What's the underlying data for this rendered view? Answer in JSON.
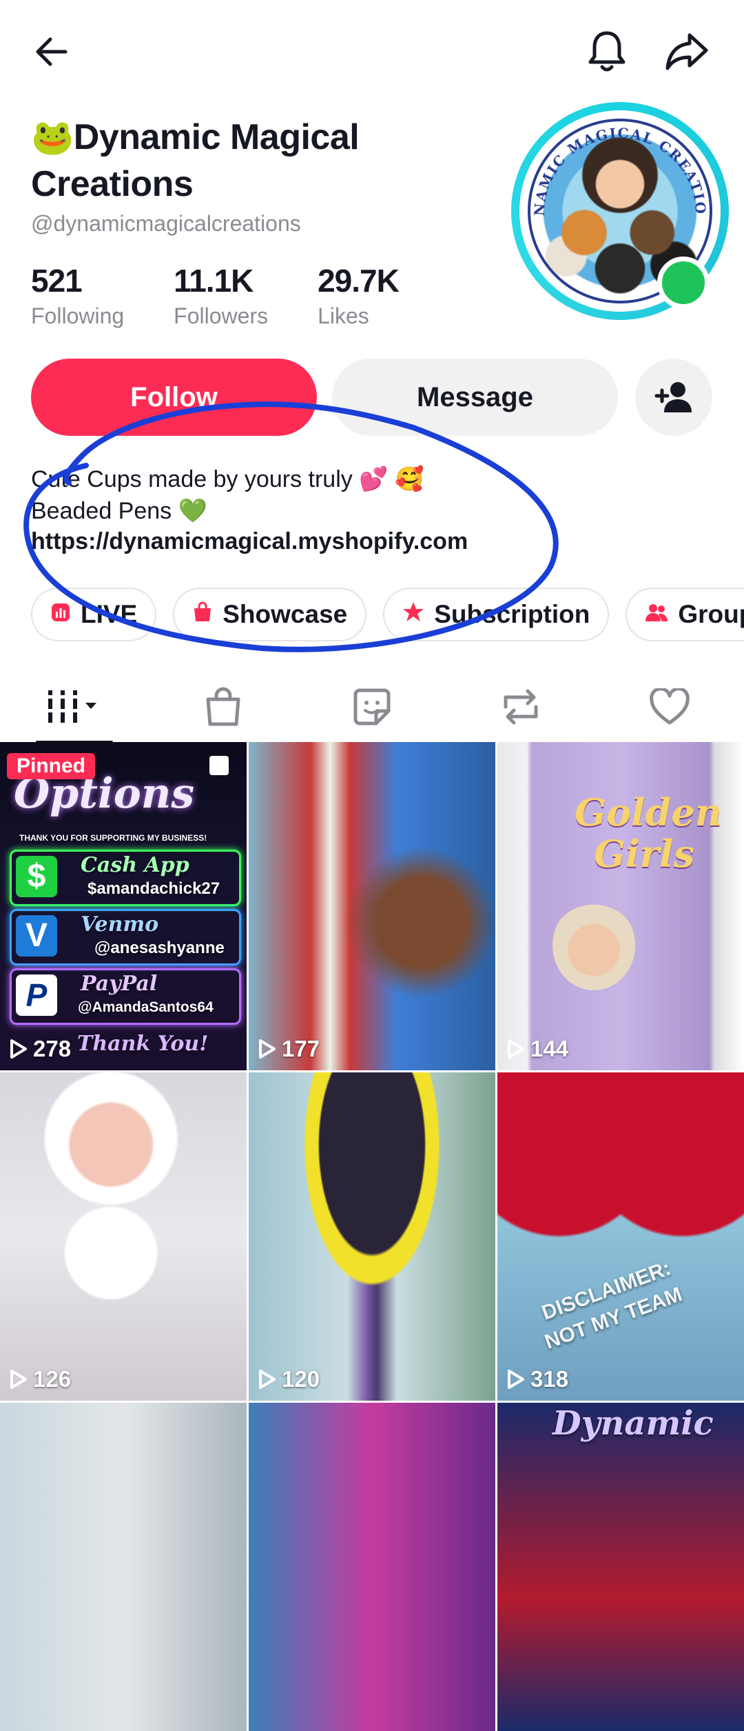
{
  "profile": {
    "name_line1": "Dynamic Magical",
    "name_line2": "Creations",
    "name_emoji": "🐸",
    "handle": "@dynamicmagicalcreations",
    "stats": [
      {
        "value": "521",
        "label": "Following"
      },
      {
        "value": "11.1K",
        "label": "Followers"
      },
      {
        "value": "29.7K",
        "label": "Likes"
      }
    ],
    "avatar_text": "DYNAMIC MAGICAL CREATIONS"
  },
  "actions": {
    "follow_label": "Follow",
    "message_label": "Message"
  },
  "bio": {
    "line1": "Cute Cups made by yours truly 💕 🥰",
    "line2": "Beaded Pens 💚",
    "link": "https://dynamicmagical.myshopify.com"
  },
  "chips": [
    {
      "label": "LIVE",
      "icon": "live-icon"
    },
    {
      "label": "Showcase",
      "icon": "shopping-bag-icon"
    },
    {
      "label": "Subscription",
      "icon": "star-icon"
    },
    {
      "label": "Group",
      "icon": "group-icon"
    }
  ],
  "tabs": [
    "videos-grid",
    "shop",
    "favorites-sticker",
    "reposts",
    "liked"
  ],
  "videos": [
    {
      "views": "278",
      "pinned": "Pinned",
      "texts": [
        "Options",
        "THANK YOU FOR SUPPORTING MY BUSINESS!",
        "Cash App",
        "$amandachick27",
        "Venmo",
        "@anesashyanne",
        "PayPal",
        "@AmandaSantos64",
        "Thank You!"
      ]
    },
    {
      "views": "177"
    },
    {
      "views": "144",
      "texts": [
        "Golden",
        "Girls"
      ]
    },
    {
      "views": "126"
    },
    {
      "views": "120"
    },
    {
      "views": "318",
      "texts": [
        "DISCLAIMER:",
        "NOT MY TEAM"
      ]
    },
    {
      "views": ""
    },
    {
      "views": ""
    },
    {
      "views": "",
      "texts": [
        "Dynamic"
      ]
    }
  ],
  "colors": {
    "accent": "#fe2c55",
    "online": "#1ec45a",
    "annotation": "#1a3fd6",
    "ring": "#1ad3e0"
  }
}
